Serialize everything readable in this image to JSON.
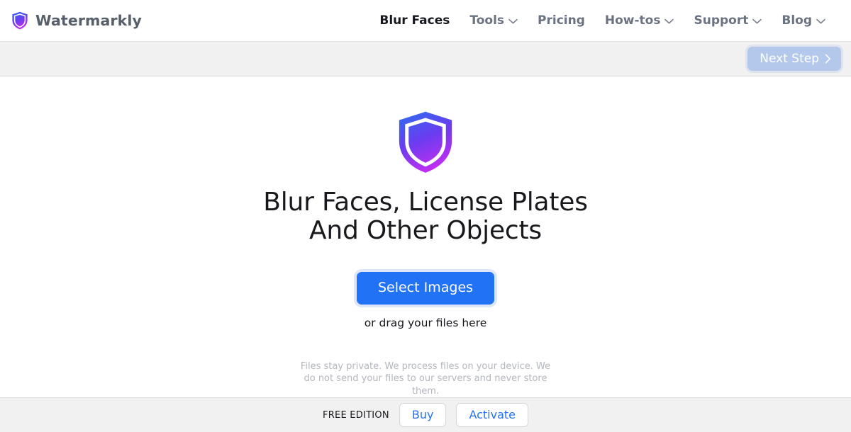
{
  "header": {
    "brand": {
      "name": "Watermarkly",
      "icon": "shield-icon"
    },
    "nav": [
      {
        "label": "Blur Faces",
        "active": true,
        "caret": false
      },
      {
        "label": "Tools",
        "active": false,
        "caret": true
      },
      {
        "label": "Pricing",
        "active": false,
        "caret": false
      },
      {
        "label": "How-tos",
        "active": false,
        "caret": true
      },
      {
        "label": "Support",
        "active": false,
        "caret": true
      },
      {
        "label": "Blog",
        "active": false,
        "caret": true
      }
    ]
  },
  "toolbar": {
    "next_step_label": "Next Step",
    "next_step_icon": "chevron-right-icon",
    "next_step_disabled": true
  },
  "main": {
    "hero_icon": "shield-icon",
    "title_line1": "Blur Faces, License Plates",
    "title_line2": "And Other Objects",
    "select_images_label": "Select Images",
    "drag_hint": "or drag your files here",
    "privacy_note": "Files stay private. We process files on your device. We do not send your files to our servers and never store them."
  },
  "footer": {
    "edition_label": "FREE EDITION",
    "buy_label": "Buy",
    "activate_label": "Activate"
  },
  "colors": {
    "accent_blue": "#2272f5",
    "disabled_blue": "#b4c8ec",
    "shield_top": "#2f6bf0",
    "shield_bottom": "#c02ef0",
    "bar_gray": "#f1f1f1",
    "muted_text": "#6b7280"
  }
}
